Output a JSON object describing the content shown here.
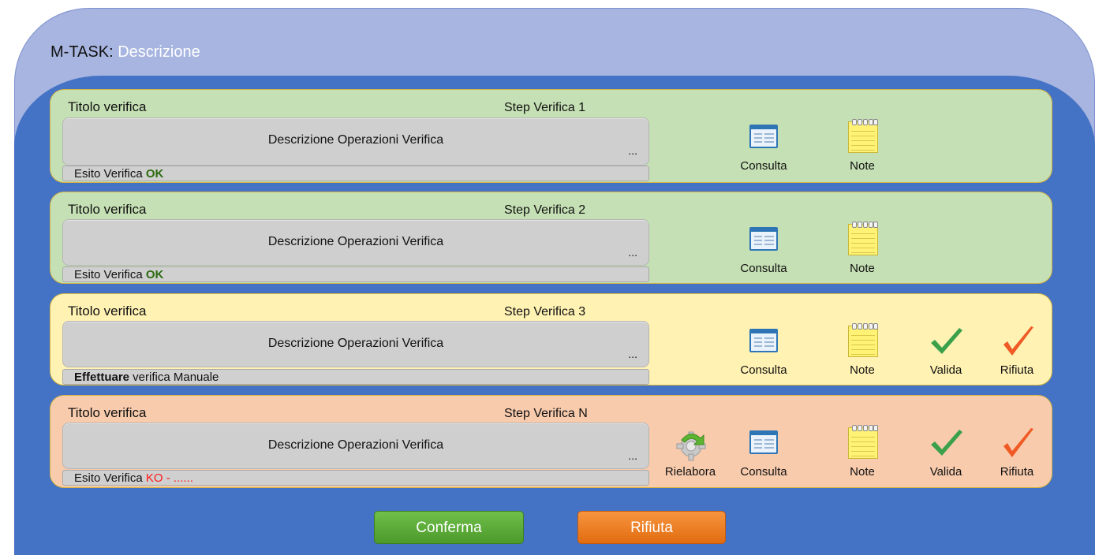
{
  "header": {
    "prefix": "M-TASK:",
    "description": "Descrizione"
  },
  "steps": [
    {
      "title": "Titolo verifica",
      "step": "Step Verifica 1",
      "description": "Descrizione Operazioni Verifica",
      "ellipsis": "...",
      "status_prefix": "Esito Verifica ",
      "status_value": "OK",
      "actions": [
        "Consulta",
        "Note"
      ]
    },
    {
      "title": "Titolo verifica",
      "step": "Step Verifica 2",
      "description": "Descrizione Operazioni Verifica",
      "ellipsis": "...",
      "status_prefix": "Esito Verifica ",
      "status_value": "OK",
      "actions": [
        "Consulta",
        "Note"
      ]
    },
    {
      "title": "Titolo verifica",
      "step": "Step Verifica 3",
      "description": "Descrizione Operazioni Verifica",
      "ellipsis": "...",
      "status_bold": "Effettuare",
      "status_rest": " verifica Manuale",
      "actions": [
        "Consulta",
        "Note",
        "Valida",
        "Rifiuta"
      ]
    },
    {
      "title": "Titolo verifica",
      "step": "Step Verifica N",
      "description": "Descrizione Operazioni Verifica",
      "ellipsis": "...",
      "status_prefix": "Esito Verifica ",
      "status_value": "KO - ......",
      "actions": [
        "Rielabora",
        "Consulta",
        "Note",
        "Valida",
        "Rifiuta"
      ]
    }
  ],
  "buttons": {
    "confirm": "Conferma",
    "reject": "Rifiuta"
  },
  "colors": {
    "outer": "#a7b5e0",
    "inner": "#4472c4",
    "ok_card": "#c5e0b4",
    "manual_card": "#fff2b3",
    "ko_card": "#f8cbad",
    "ok_text": "#2e6b12",
    "ko_text": "#ff1a1a",
    "confirm_button": "#5aa935",
    "reject_button": "#ef7d22"
  },
  "icons": {
    "consulta": "table-window-icon",
    "note": "notepad-icon",
    "valida": "green-checkmark-icon",
    "rifiuta": "orange-checkmark-icon",
    "rielabora": "gear-refresh-icon"
  }
}
